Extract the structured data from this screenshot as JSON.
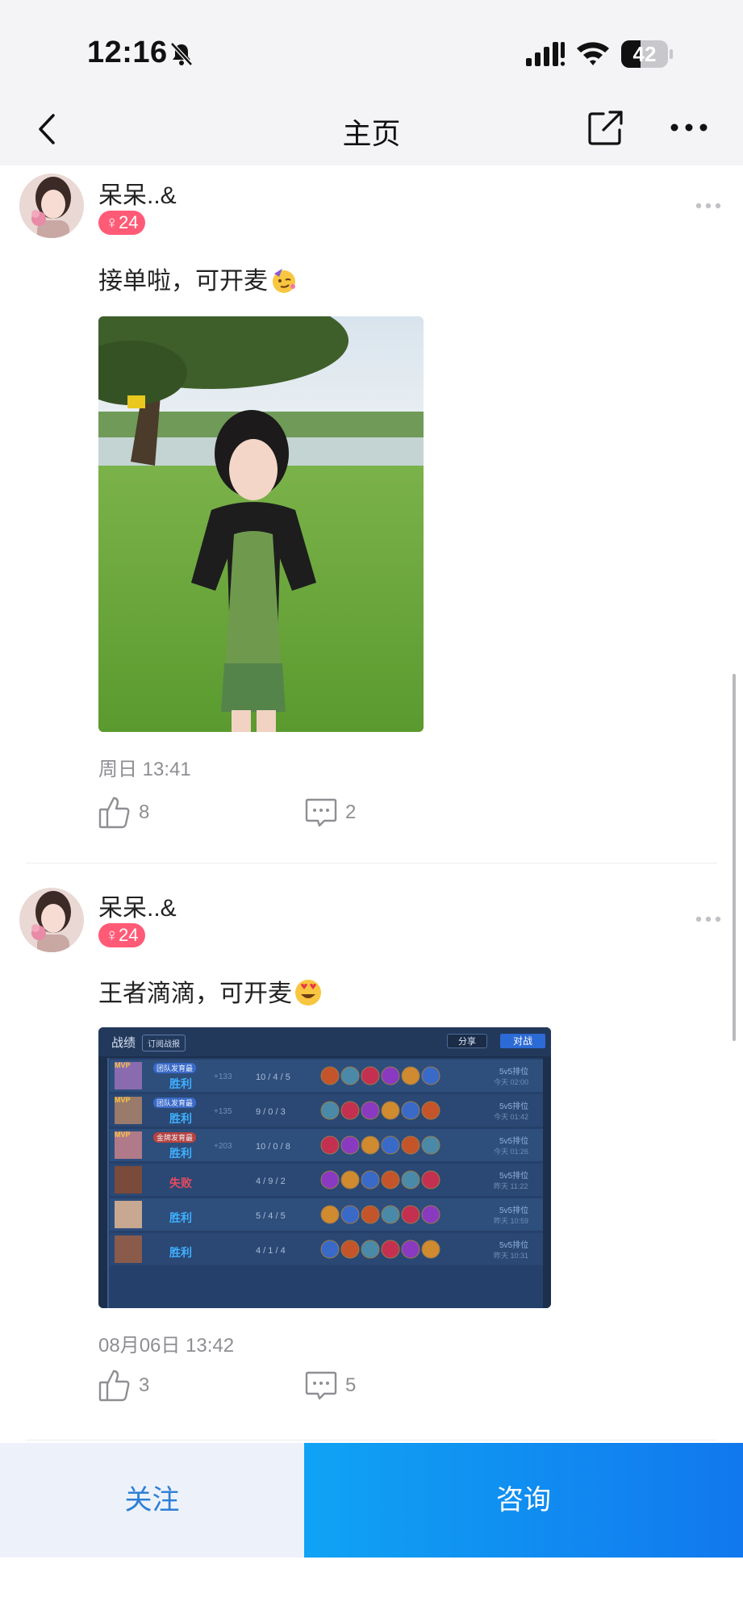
{
  "status_bar": {
    "time": "12:16",
    "battery": "42",
    "battery_level": 0.42
  },
  "nav": {
    "title": "主页",
    "back_icon": "chevron-left-icon",
    "share_icon": "share-icon",
    "more_icon": "more-dots-icon"
  },
  "posts": [
    {
      "username": "呆呆..&",
      "gender_age": "♀24",
      "text": "接单啦，可开麦",
      "emoji": "partying-face-emoji",
      "date": "周日 13:41",
      "likes": "8",
      "comments": "2"
    },
    {
      "username": "呆呆..&",
      "gender_age": "♀24",
      "text": "王者滴滴，可开麦",
      "emoji": "heart-eyes-emoji",
      "date": "08月06日 13:42",
      "likes": "3",
      "comments": "5",
      "game_card": {
        "tab": "战绩",
        "subscribe": "订阅战报",
        "share": "分享",
        "battle": "对战",
        "rows": [
          {
            "mvp": "MVP",
            "tag": "团队发育最",
            "result": "胜利",
            "delta": "+133",
            "kda": "10 / 4 / 5",
            "mode": "5v5排位",
            "time": "今天 02:00"
          },
          {
            "mvp": "MVP",
            "tag": "团队发育最",
            "result": "胜利",
            "delta": "+135",
            "kda": "9 / 0 / 3",
            "mode": "5v5排位",
            "time": "今天 01:42"
          },
          {
            "mvp": "MVP",
            "tag": "金牌发育最",
            "result": "胜利",
            "delta": "+203",
            "kda": "10 / 0 / 8",
            "mode": "5v5排位",
            "time": "今天 01:26"
          },
          {
            "mvp": "",
            "tag": "",
            "result": "失败",
            "delta": "",
            "kda": "4 / 9 / 2",
            "mode": "5v5排位",
            "time": "昨天 11:22"
          },
          {
            "mvp": "",
            "tag": "",
            "result": "胜利",
            "delta": "",
            "kda": "5 / 4 / 5",
            "mode": "5v5排位",
            "time": "昨天 10:59"
          },
          {
            "mvp": "",
            "tag": "",
            "result": "胜利",
            "delta": "",
            "kda": "4 / 1 / 4",
            "mode": "5v5排位",
            "time": "昨天 10:31"
          }
        ]
      }
    }
  ],
  "bottom": {
    "follow": "关注",
    "consult": "咨询"
  },
  "colors": {
    "accent": "#1178ee",
    "badge": "#ff5a76",
    "win": "#3fb0ff",
    "loss": "#e84a5f"
  }
}
